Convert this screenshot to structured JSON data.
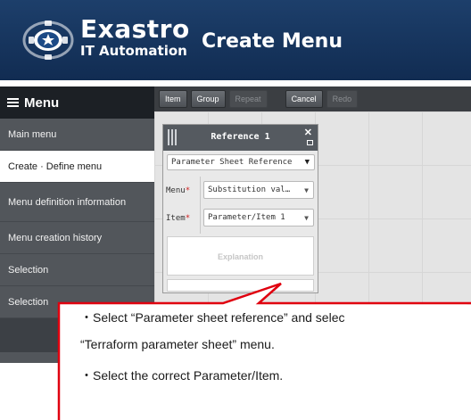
{
  "header": {
    "brand_name": "Exastro",
    "brand_sub": "IT Automation",
    "title": "Create Menu",
    "logo_icon": "exastro-gear-logo"
  },
  "sidebar": {
    "heading": "Menu",
    "items": [
      {
        "label": "Main menu",
        "active": false
      },
      {
        "label": "Create · Define menu",
        "active": true
      },
      {
        "label": "Menu definition information",
        "active": false
      },
      {
        "label": "Menu creation history",
        "active": false
      },
      {
        "label": "Selection",
        "active": false
      },
      {
        "label": "Selection",
        "active": false
      }
    ]
  },
  "toolbar": {
    "buttons": [
      {
        "label": "Item",
        "enabled": true
      },
      {
        "label": "Group",
        "enabled": true
      },
      {
        "label": "Repeat",
        "enabled": false
      },
      {
        "label": "Cancel",
        "enabled": true
      },
      {
        "label": "Redo",
        "enabled": false
      }
    ]
  },
  "reference_block": {
    "title": "Reference 1",
    "type_select": "Parameter Sheet Reference",
    "menu_label": "Menu",
    "menu_value": "Substitution val…",
    "item_label": "Item",
    "item_value": "Parameter/Item 1",
    "required_mark": "*",
    "explanation_placeholder": "Explanation"
  },
  "callout": {
    "line1": "・Select “Parameter sheet reference” and selec",
    "line2": "“Terraform parameter sheet” menu.",
    "line3": "・Select the correct Parameter/Item."
  },
  "colors": {
    "header_bg": "#163660",
    "sidebar_bg": "#52565b",
    "callout_border": "#e0000f",
    "required": "#d22222"
  }
}
